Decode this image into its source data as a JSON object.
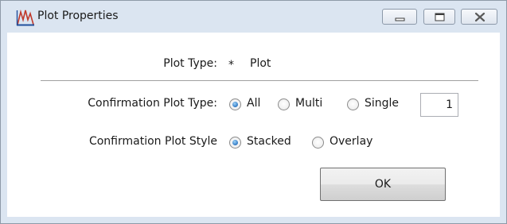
{
  "window": {
    "title": "Plot Properties",
    "icon": "peaks-chart-icon",
    "controls": [
      "minimize-icon",
      "maximize-icon",
      "close-icon"
    ]
  },
  "plot_type": {
    "label": "Plot Type:",
    "marker": "*",
    "value": "Plot"
  },
  "confirmation_plot_type": {
    "label": "Confirmation Plot Type:",
    "options": [
      {
        "label": "All",
        "checked": true
      },
      {
        "label": "Multi",
        "checked": false
      },
      {
        "label": "Single",
        "checked": false
      }
    ],
    "count_value": "1"
  },
  "confirmation_plot_style": {
    "label": "Confirmation Plot Style",
    "options": [
      {
        "label": "Stacked",
        "checked": true
      },
      {
        "label": "Overlay",
        "checked": false
      }
    ]
  },
  "buttons": {
    "ok_label": "OK"
  },
  "colors": {
    "title_bar": "#dbe5f1",
    "radio_accent": "#2f78c4",
    "icon_red": "#c0392b",
    "icon_blue": "#1f4e9c"
  }
}
